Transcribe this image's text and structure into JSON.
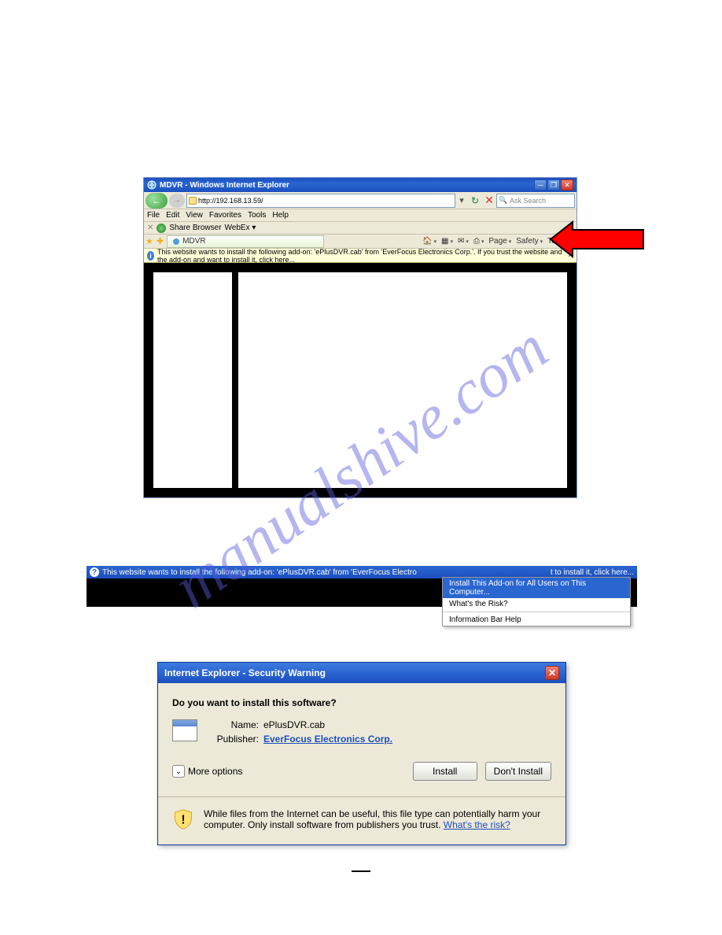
{
  "watermark": "manualshive.com",
  "browser": {
    "title": "MDVR - Windows Internet Explorer",
    "url": "http://192.168.13.59/",
    "search_placeholder": "Ask Search",
    "menus": {
      "file": "File",
      "edit": "Edit",
      "view": "View",
      "favorites": "Favorites",
      "tools": "Tools",
      "help": "Help"
    },
    "extra_toolbar": {
      "share": "Share Browser",
      "webex": "WebEx ▾"
    },
    "tab_label": "MDVR",
    "right_tools": {
      "page": "Page",
      "safety": "Safety",
      "tools": "Tools"
    },
    "infobar_text": "This website wants to install the following add-on: 'ePlusDVR.cab' from 'EverFocus Electronics Corp.'. If you trust the website and the add-on and want to install it, click here..."
  },
  "infobar_wide": {
    "text_left": "This website wants to install the following add-on: 'ePlusDVR.cab' from 'EverFocus Electro",
    "text_right": "t to install it, click here...",
    "menu": {
      "install": "Install This Add-on for All Users on This Computer...",
      "risk": "What's the Risk?",
      "help": "Information Bar Help"
    }
  },
  "dialog": {
    "title": "Internet Explorer - Security Warning",
    "question": "Do you want to install this software?",
    "name_label": "Name:",
    "name_value": "ePlusDVR.cab",
    "publisher_label": "Publisher:",
    "publisher_value": "EverFocus Electronics Corp.",
    "more_options": "More options",
    "install_btn": "Install",
    "dont_install_btn": "Don't Install",
    "warning_text": "While files from the Internet can be useful, this file type can potentially harm your computer. Only install software from publishers you trust. ",
    "whats_risk": "What's the risk?"
  }
}
